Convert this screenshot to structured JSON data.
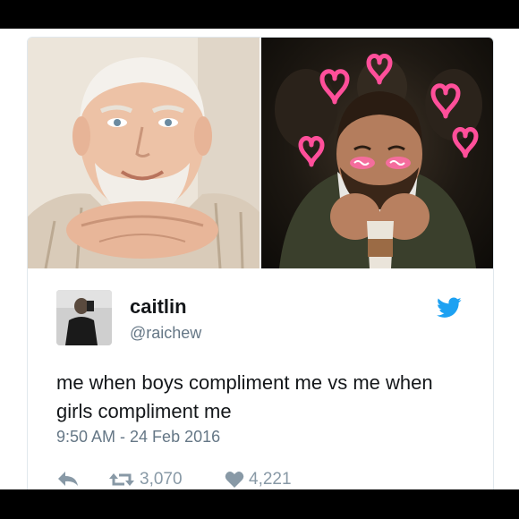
{
  "tweet": {
    "display_name": "caitlin",
    "handle": "@raichew",
    "text": "me when boys compliment me vs me when girls compliment me",
    "timestamp": "9:50 AM - 24 Feb 2016",
    "retweets": "3,070",
    "likes": "4,221"
  },
  "icons": {
    "brand": "twitter-bird-icon",
    "reply": "reply-icon",
    "retweet": "retweet-icon",
    "like": "heart-icon"
  },
  "colors": {
    "twitter_blue": "#1da1f2",
    "text_primary": "#14171a",
    "text_secondary": "#657786",
    "action_gray": "#8899a6",
    "hearts_pink": "#ff4f9a"
  }
}
